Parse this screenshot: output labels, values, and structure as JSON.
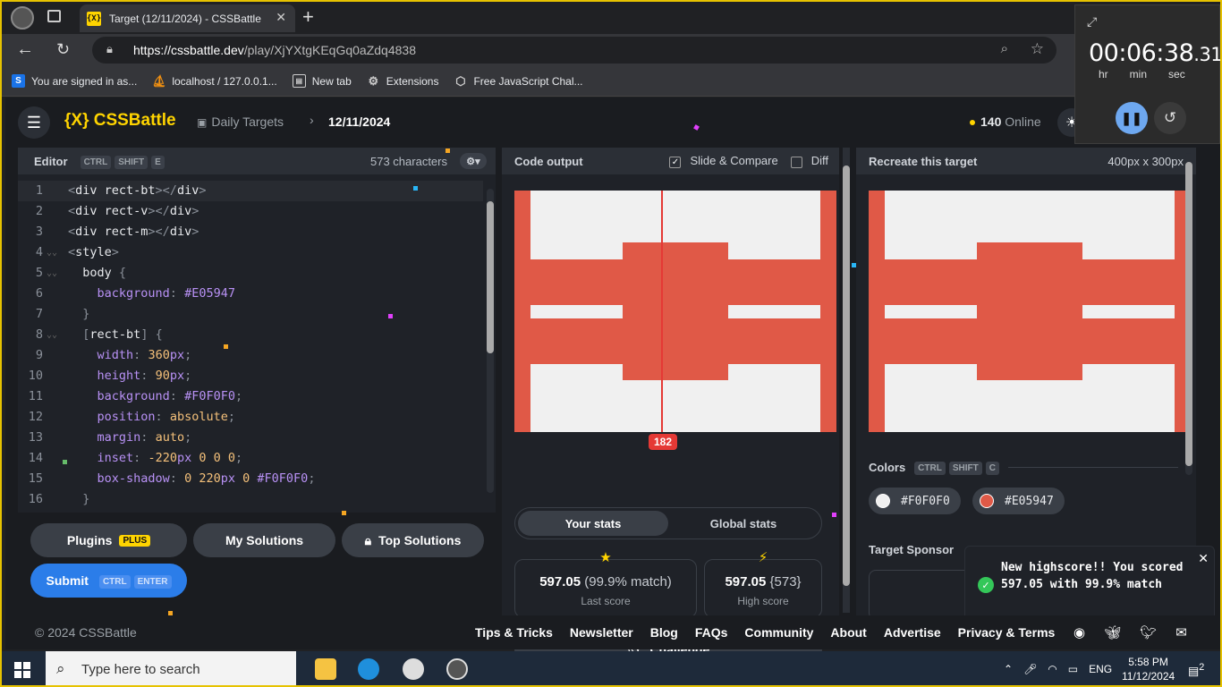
{
  "browser": {
    "tab_title": "Target (12/11/2024) - CSSBattle",
    "tab_favicon": "{X}",
    "url_host": "https://cssbattle.dev",
    "url_path": "/play/XjYXtgKEqGq0aZdq4838",
    "bookmarks": [
      {
        "label": "You are signed in as...",
        "icon": "S",
        "color": "#1a73e8"
      },
      {
        "label": "localhost / 127.0.0.1...",
        "icon": "pma-icon",
        "color": "#f29111"
      },
      {
        "label": "New tab",
        "icon": "newtab-icon",
        "color": "#5f6368"
      },
      {
        "label": "Extensions",
        "icon": "puzzle-icon",
        "color": "#5f6368"
      },
      {
        "label": "Free JavaScript Chal...",
        "icon": "cube-icon",
        "color": "#5f6368"
      }
    ]
  },
  "timer": {
    "time": "00:06:38",
    "fraction": ".31",
    "units": [
      "hr",
      "min",
      "sec"
    ]
  },
  "header": {
    "logo": "{X} CSSBattle",
    "crumb1": "Daily Targets",
    "crumb2": "12/11/2024",
    "online_count": "140",
    "online_label": "Online"
  },
  "editor": {
    "title": "Editor",
    "shortcut": [
      "CTRL",
      "SHIFT",
      "E"
    ],
    "char_count": "573 characters",
    "lines": [
      {
        "n": "1",
        "fold": "",
        "html": "<span class='tk-br'>&lt;</span><span class='tk-tag'>div rect-bt</span><span class='tk-br'>&gt;&lt;/</span><span class='tk-tag'>div</span><span class='tk-br'>&gt;</span>"
      },
      {
        "n": "2",
        "fold": "",
        "html": "<span class='tk-br'>&lt;</span><span class='tk-tag'>div rect-v</span><span class='tk-br'>&gt;&lt;/</span><span class='tk-tag'>div</span><span class='tk-br'>&gt;</span>"
      },
      {
        "n": "3",
        "fold": "",
        "html": "<span class='tk-br'>&lt;</span><span class='tk-tag'>div rect-m</span><span class='tk-br'>&gt;&lt;/</span><span class='tk-tag'>div</span><span class='tk-br'>&gt;</span>"
      },
      {
        "n": "4",
        "fold": "v",
        "html": "<span class='tk-br'>&lt;</span><span class='tk-tag'>style</span><span class='tk-br'>&gt;</span>"
      },
      {
        "n": "5",
        "fold": "v",
        "html": "  <span class='tk-sel'>body</span> <span class='tk-br'>{</span>"
      },
      {
        "n": "6",
        "fold": "",
        "html": "    <span class='tk-prop'>background</span><span class='tk-br'>:</span> <span class='tk-hash'>#E05947</span>"
      },
      {
        "n": "7",
        "fold": "",
        "html": "  <span class='tk-br'>}</span>"
      },
      {
        "n": "8",
        "fold": "v",
        "html": "  <span class='tk-br'>[</span><span class='tk-sel'>rect-bt</span><span class='tk-br'>]</span> <span class='tk-br'>{</span>"
      },
      {
        "n": "9",
        "fold": "",
        "html": "    <span class='tk-prop'>width</span><span class='tk-br'>:</span> <span class='tk-num'>360</span><span class='tk-prop'>px</span><span class='tk-br'>;</span>"
      },
      {
        "n": "10",
        "fold": "",
        "html": "    <span class='tk-prop'>height</span><span class='tk-br'>:</span> <span class='tk-num'>90</span><span class='tk-prop'>px</span><span class='tk-br'>;</span>"
      },
      {
        "n": "11",
        "fold": "",
        "html": "    <span class='tk-prop'>background</span><span class='tk-br'>:</span> <span class='tk-hash'>#F0F0F0</span><span class='tk-br'>;</span>"
      },
      {
        "n": "12",
        "fold": "",
        "html": "    <span class='tk-prop'>position</span><span class='tk-br'>:</span> <span class='tk-val'>absolute</span><span class='tk-br'>;</span>"
      },
      {
        "n": "13",
        "fold": "",
        "html": "    <span class='tk-prop'>margin</span><span class='tk-br'>:</span> <span class='tk-val'>auto</span><span class='tk-br'>;</span>"
      },
      {
        "n": "14",
        "fold": "",
        "html": "    <span class='tk-prop'>inset</span><span class='tk-br'>:</span> <span class='tk-num'>-220</span><span class='tk-prop'>px</span> <span class='tk-num'>0 0 0</span><span class='tk-br'>;</span>"
      },
      {
        "n": "15",
        "fold": "",
        "html": "    <span class='tk-prop'>box-shadow</span><span class='tk-br'>:</span> <span class='tk-num'>0 220</span><span class='tk-prop'>px</span> <span class='tk-num'>0</span> <span class='tk-hash'>#F0F0F0</span><span class='tk-br'>;</span>"
      },
      {
        "n": "16",
        "fold": "",
        "html": "  <span class='tk-br'>}</span>"
      }
    ]
  },
  "buttons": {
    "plugins": "Plugins",
    "plus": "PLUS",
    "my_solutions": "My Solutions",
    "top_solutions": "Top Solutions",
    "submit": "Submit",
    "submit_keys": [
      "CTRL",
      "ENTER"
    ]
  },
  "output": {
    "title": "Code output",
    "slide_compare": "Slide & Compare",
    "diff": "Diff",
    "slider_value": "182",
    "tab_your": "Your stats",
    "tab_global": "Global stats",
    "last_score": "597.05",
    "last_match": "(99.9% match)",
    "last_label": "Last score",
    "high_score": "597.05",
    "high_chars": "{573}",
    "high_label": "High score",
    "challenge": "Challenge"
  },
  "target": {
    "title": "Recreate this target",
    "dimensions": "400px x 300px",
    "colors_label": "Colors",
    "colors_keys": [
      "CTRL",
      "SHIFT",
      "C"
    ],
    "colors": [
      {
        "hex": "#F0F0F0"
      },
      {
        "hex": "#E05947"
      }
    ],
    "sponsor_label": "Target Sponsor"
  },
  "toast": {
    "message": "New highscore!! You scored 597.05 with 99.9% match"
  },
  "footer": {
    "copyright": "© 2024 CSSBattle",
    "links": [
      "Tips & Tricks",
      "Newsletter",
      "Blog",
      "FAQs",
      "Community",
      "About",
      "Advertise",
      "Privacy & Terms"
    ]
  },
  "taskbar": {
    "search_placeholder": "Type here to search",
    "lang": "ENG",
    "time": "5:58 PM",
    "date": "11/12/2024",
    "notifications": "2"
  }
}
